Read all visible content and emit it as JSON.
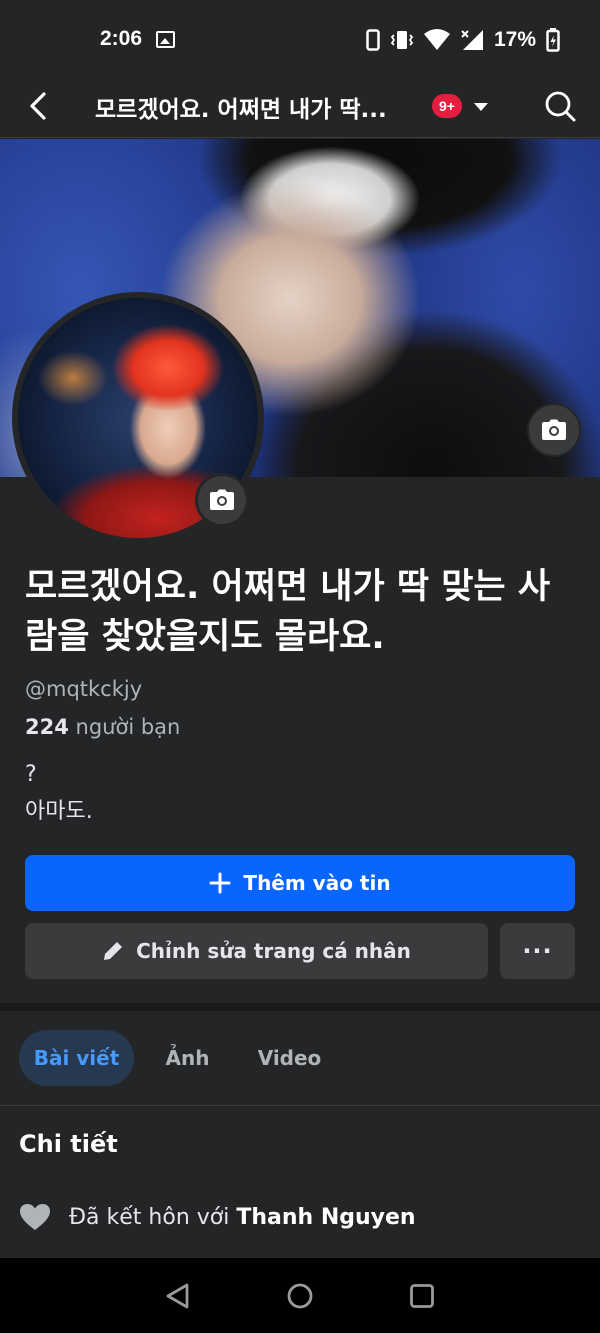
{
  "status_bar": {
    "time": "2:06",
    "battery": "17%",
    "icons": [
      "image-icon",
      "phone-icon",
      "vibrate-icon",
      "wifi-icon",
      "signal-icon",
      "battery-icon"
    ]
  },
  "header": {
    "title": "모르겠어요. 어쩌면 내가 딱...",
    "notification_count": "9+"
  },
  "profile": {
    "name": "모르겠어요. 어쩌면 내가 딱 맞는 사람을 찾았을지도 몰라요.",
    "username": "@mqtkckjy",
    "friends_count": "224",
    "friends_label": " người bạn",
    "bio_line1": "?",
    "bio_line2": "아마도."
  },
  "actions": {
    "add_story": "Thêm vào tin",
    "edit_profile": "Chỉnh sửa trang cá nhân",
    "more": "···"
  },
  "tabs": [
    {
      "label": "Bài viết",
      "active": true
    },
    {
      "label": "Ảnh",
      "active": false
    },
    {
      "label": "Video",
      "active": false
    }
  ],
  "details": {
    "title": "Chi tiết",
    "relationship_prefix": "Đã kết hôn với ",
    "relationship_partner": "Thanh Nguyen"
  },
  "colors": {
    "background": "#242526",
    "primary_button": "#0866ff",
    "badge": "#e41e3f",
    "active_tab_bg": "#263951",
    "active_tab_text": "#4599ff"
  }
}
